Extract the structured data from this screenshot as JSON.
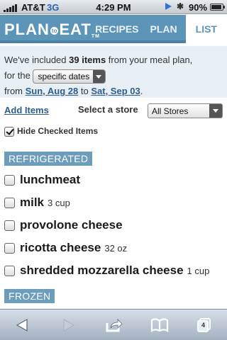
{
  "status_bar": {
    "carrier": "AT&T",
    "network": "3G",
    "time": "4:29 PM",
    "battery_text": "90%",
    "battery_level": 0.9
  },
  "header": {
    "logo_left": "PLAN",
    "logo_mid": "to",
    "logo_right": "EAT",
    "logo_tm": "TM",
    "tabs": [
      {
        "label": "RECIPES"
      },
      {
        "label": "PLAN"
      },
      {
        "label": "LIST"
      }
    ],
    "active_tab": "LIST"
  },
  "info": {
    "line1_pre": "We've included ",
    "count_text": "39 items",
    "line1_post": " from your meal plan,",
    "line2_pre": "for the",
    "dates_select": "specific dates",
    "line3_pre": "from ",
    "date_from": "Sun, Aug 28",
    "line3_mid": " to ",
    "date_to": "Sat, Sep 03",
    "line3_post": "."
  },
  "controls": {
    "add_items": "Add Items",
    "store_label": "Select a store",
    "store_value": "All Stores",
    "hide_checked": "Hide Checked Items",
    "hide_checked_on": true
  },
  "sections": {
    "refrigerated": "REFRIGERATED",
    "frozen": "FROZEN"
  },
  "items": [
    {
      "name": "lunchmeat",
      "qty": ""
    },
    {
      "name": "milk",
      "qty": "3 cup"
    },
    {
      "name": "provolone cheese",
      "qty": ""
    },
    {
      "name": "ricotta cheese",
      "qty": "32 oz"
    },
    {
      "name": "shredded mozzarella cheese",
      "qty": "1 cup"
    }
  ],
  "toolbar": {
    "icons": [
      "back-arrow-icon",
      "forward-arrow-icon",
      "share-icon",
      "bookmarks-icon",
      "pages-icon"
    ],
    "pages_count": "4"
  },
  "colors": {
    "header_blue": "#5d95b8",
    "section_blue": "#6d9dbd",
    "link_blue": "#2d5e8e",
    "info_bg": "#e8f0f6"
  }
}
